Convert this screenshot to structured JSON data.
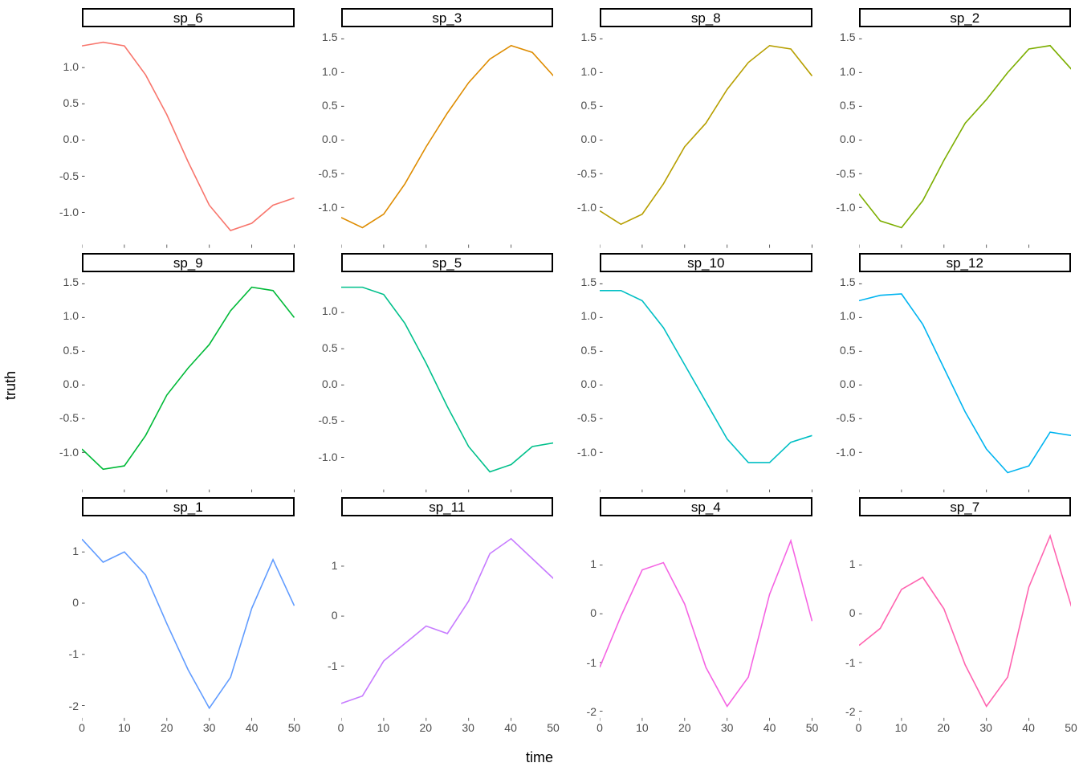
{
  "labels": {
    "xlabel": "time",
    "ylabel": "truth"
  },
  "chart_data": [
    {
      "name": "sp_6",
      "color": "#F8766D",
      "type": "line",
      "xlim": [
        0,
        50
      ],
      "ylim": [
        -1.49,
        1.49
      ],
      "yticks": [
        -1.0,
        -0.5,
        0.0,
        0.5,
        1.0
      ],
      "xticks": [
        0,
        10,
        20,
        30,
        40,
        50
      ],
      "x": [
        0,
        5,
        10,
        15,
        20,
        25,
        30,
        35,
        40,
        45,
        50
      ],
      "y": [
        1.3,
        1.35,
        1.3,
        0.9,
        0.35,
        -0.3,
        -0.9,
        -1.25,
        -1.15,
        -0.9,
        -0.8
      ]
    },
    {
      "name": "sp_3",
      "color": "#DE8C00",
      "type": "line",
      "xlim": [
        0,
        50
      ],
      "ylim": [
        -1.6,
        1.6
      ],
      "yticks": [
        -1.0,
        -0.5,
        0.0,
        0.5,
        1.0,
        1.5
      ],
      "xticks": [
        0,
        10,
        20,
        30,
        40,
        50
      ],
      "x": [
        0,
        5,
        10,
        15,
        20,
        25,
        30,
        35,
        40,
        45,
        50
      ],
      "y": [
        -1.15,
        -1.3,
        -1.1,
        -0.65,
        -0.1,
        0.4,
        0.85,
        1.2,
        1.4,
        1.3,
        0.95
      ]
    },
    {
      "name": "sp_8",
      "color": "#B79F00",
      "type": "line",
      "xlim": [
        0,
        50
      ],
      "ylim": [
        -1.6,
        1.6
      ],
      "yticks": [
        -1.0,
        -0.5,
        0.0,
        0.5,
        1.0,
        1.5
      ],
      "xticks": [
        0,
        10,
        20,
        30,
        40,
        50
      ],
      "x": [
        0,
        5,
        10,
        15,
        20,
        25,
        30,
        35,
        40,
        45,
        50
      ],
      "y": [
        -1.05,
        -1.25,
        -1.1,
        -0.65,
        -0.1,
        0.25,
        0.75,
        1.15,
        1.4,
        1.35,
        0.95
      ]
    },
    {
      "name": "sp_2",
      "color": "#7CAE00",
      "type": "line",
      "xlim": [
        0,
        50
      ],
      "ylim": [
        -1.6,
        1.6
      ],
      "yticks": [
        -1.0,
        -0.5,
        0.0,
        0.5,
        1.0,
        1.5
      ],
      "xticks": [
        0,
        10,
        20,
        30,
        40,
        50
      ],
      "x": [
        0,
        5,
        10,
        15,
        20,
        25,
        30,
        35,
        40,
        45,
        50
      ],
      "y": [
        -0.8,
        -1.2,
        -1.3,
        -0.9,
        -0.3,
        0.25,
        0.6,
        1.0,
        1.35,
        1.4,
        1.05
      ]
    },
    {
      "name": "sp_9",
      "color": "#00BA38",
      "type": "line",
      "xlim": [
        0,
        50
      ],
      "ylim": [
        -1.6,
        1.6
      ],
      "yticks": [
        -1.0,
        -0.5,
        0.0,
        0.5,
        1.0,
        1.5
      ],
      "xticks": [
        0,
        10,
        20,
        30,
        40,
        50
      ],
      "x": [
        0,
        5,
        10,
        15,
        20,
        25,
        30,
        35,
        40,
        45,
        50
      ],
      "y": [
        -0.95,
        -1.25,
        -1.2,
        -0.75,
        -0.15,
        0.25,
        0.6,
        1.1,
        1.45,
        1.4,
        1.0
      ]
    },
    {
      "name": "sp_5",
      "color": "#00C08B",
      "type": "line",
      "xlim": [
        0,
        50
      ],
      "ylim": [
        -1.49,
        1.49
      ],
      "yticks": [
        -1.0,
        -0.5,
        0.0,
        0.5,
        1.0
      ],
      "xticks": [
        0,
        10,
        20,
        30,
        40,
        50
      ],
      "x": [
        0,
        5,
        10,
        15,
        20,
        25,
        30,
        35,
        40,
        45,
        50
      ],
      "y": [
        1.35,
        1.35,
        1.25,
        0.85,
        0.3,
        -0.3,
        -0.85,
        -1.2,
        -1.1,
        -0.85,
        -0.8
      ]
    },
    {
      "name": "sp_10",
      "color": "#00BFC4",
      "type": "line",
      "xlim": [
        0,
        50
      ],
      "ylim": [
        -1.6,
        1.6
      ],
      "yticks": [
        -1.0,
        -0.5,
        0.0,
        0.5,
        1.0,
        1.5
      ],
      "xticks": [
        0,
        10,
        20,
        30,
        40,
        50
      ],
      "x": [
        0,
        5,
        10,
        15,
        20,
        25,
        30,
        35,
        40,
        45,
        50
      ],
      "y": [
        1.4,
        1.4,
        1.25,
        0.85,
        0.3,
        -0.25,
        -0.8,
        -1.15,
        -1.15,
        -0.85,
        -0.75
      ]
    },
    {
      "name": "sp_12",
      "color": "#00B4F0",
      "type": "line",
      "xlim": [
        0,
        50
      ],
      "ylim": [
        -1.6,
        1.6
      ],
      "yticks": [
        -1.0,
        -0.5,
        0.0,
        0.5,
        1.0,
        1.5
      ],
      "xticks": [
        0,
        10,
        20,
        30,
        40,
        50
      ],
      "x": [
        0,
        5,
        10,
        15,
        20,
        25,
        30,
        35,
        40,
        45,
        50
      ],
      "y": [
        1.25,
        1.33,
        1.35,
        0.9,
        0.25,
        -0.4,
        -0.95,
        -1.3,
        -1.2,
        -0.7,
        -0.75
      ]
    },
    {
      "name": "sp_1",
      "color": "#619CFF",
      "type": "line",
      "xlim": [
        0,
        50
      ],
      "ylim": [
        -2.3,
        1.6
      ],
      "yticks": [
        -2,
        -1,
        0,
        1
      ],
      "xticks": [
        0,
        10,
        20,
        30,
        40,
        50
      ],
      "x": [
        0,
        5,
        10,
        15,
        20,
        25,
        30,
        35,
        40,
        45,
        50
      ],
      "y": [
        1.25,
        0.8,
        1.0,
        0.55,
        -0.4,
        -1.3,
        -2.05,
        -1.45,
        -0.1,
        0.85,
        -0.05
      ]
    },
    {
      "name": "sp_11",
      "color": "#C77CFF",
      "type": "line",
      "xlim": [
        0,
        50
      ],
      "ylim": [
        -2.1,
        1.9
      ],
      "yticks": [
        -1,
        0,
        1
      ],
      "xticks": [
        0,
        10,
        20,
        30,
        40,
        50
      ],
      "x": [
        0,
        5,
        10,
        15,
        20,
        25,
        30,
        35,
        40,
        45,
        50
      ],
      "y": [
        -1.75,
        -1.6,
        -0.9,
        -0.55,
        -0.2,
        -0.35,
        0.3,
        1.25,
        1.55,
        1.15,
        0.75
      ]
    },
    {
      "name": "sp_4",
      "color": "#F564E3",
      "type": "line",
      "xlim": [
        0,
        50
      ],
      "ylim": [
        -2.2,
        1.9
      ],
      "yticks": [
        -2,
        -1,
        0,
        1
      ],
      "xticks": [
        0,
        10,
        20,
        30,
        40,
        50
      ],
      "x": [
        0,
        5,
        10,
        15,
        20,
        25,
        30,
        35,
        40,
        45,
        50
      ],
      "y": [
        -1.1,
        -0.05,
        0.9,
        1.05,
        0.2,
        -1.1,
        -1.9,
        -1.3,
        0.4,
        1.5,
        -0.15
      ]
    },
    {
      "name": "sp_7",
      "color": "#FF64B0",
      "type": "line",
      "xlim": [
        0,
        50
      ],
      "ylim": [
        -2.2,
        1.9
      ],
      "yticks": [
        -2,
        -1,
        0,
        1
      ],
      "xticks": [
        0,
        10,
        20,
        30,
        40,
        50
      ],
      "x": [
        0,
        5,
        10,
        15,
        20,
        25,
        30,
        35,
        40,
        45,
        50
      ],
      "y": [
        -0.65,
        -0.3,
        0.5,
        0.75,
        0.1,
        -1.05,
        -1.9,
        -1.3,
        0.55,
        1.6,
        0.15
      ]
    }
  ]
}
